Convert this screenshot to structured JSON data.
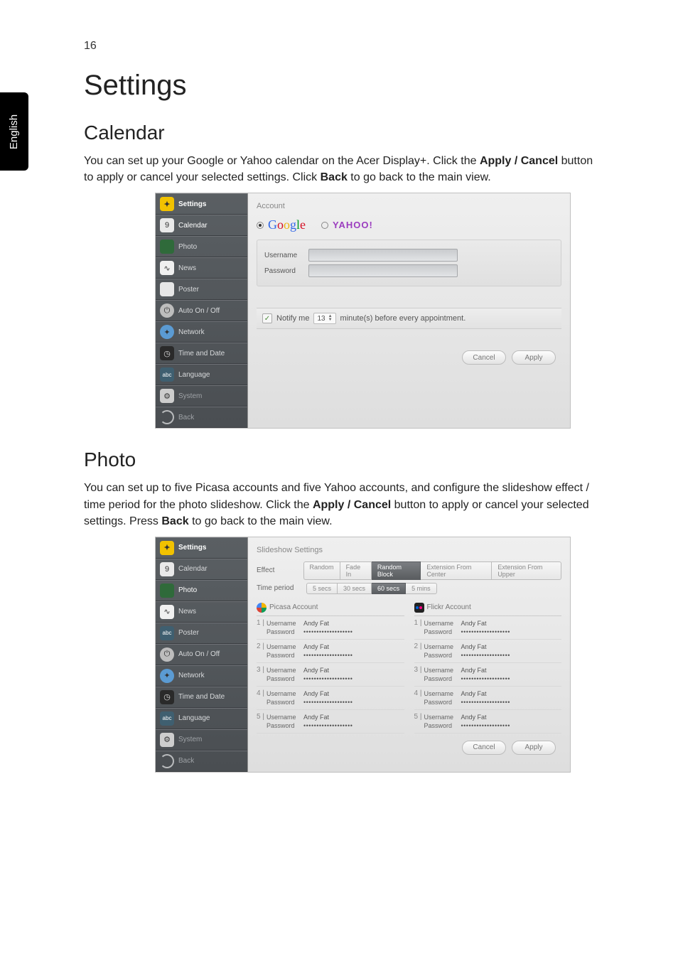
{
  "page_number": "16",
  "language_tab": "English",
  "heading_settings": "Settings",
  "calendar": {
    "heading": "Calendar",
    "para_before": "You can set up your Google or Yahoo calendar on the Acer Display+. Click the ",
    "apply_cancel": "Apply / Cancel",
    "para_mid": " button to apply or cancel your selected settings. Click ",
    "back": "Back",
    "para_after": " to go back to the main view."
  },
  "photo": {
    "heading": "Photo",
    "para_before": "You can set up to five Picasa accounts and five Yahoo accounts, and configure the slideshow effect / time period for the photo slideshow. Click the ",
    "apply_cancel": "Apply / Cancel",
    "para_mid": " button to apply or cancel your selected settings. Press ",
    "back": "Back",
    "para_after": " to go back to the main view."
  },
  "sidebar": {
    "title": "Settings",
    "items": [
      "Calendar",
      "Photo",
      "News",
      "Poster",
      "Auto On / Off",
      "Network",
      "Time and Date",
      "Language",
      "System",
      "Back"
    ]
  },
  "calendar_app": {
    "section_title": "Account",
    "radio_google": "Google",
    "radio_yahoo": "YAHOO!",
    "lbl_username": "Username",
    "lbl_password": "Password",
    "notify_label": "Notify me",
    "notify_value": "13",
    "notify_suffix": "minute(s) before every appointment.",
    "btn_cancel": "Cancel",
    "btn_apply": "Apply"
  },
  "photo_app": {
    "section_title": "Slideshow Settings",
    "lbl_effect": "Effect",
    "effects": [
      "Random",
      "Fade In",
      "Random Block",
      "Extension From Center",
      "Extension From Upper"
    ],
    "effect_selected_index": 2,
    "lbl_time": "Time period",
    "times": [
      "5 secs",
      "30 secs",
      "60 secs",
      "5 mins"
    ],
    "time_selected_index": 2,
    "picasa_title": "Picasa Account",
    "flickr_title": "Flickr Account",
    "row_lbl_username": "Username",
    "row_lbl_password": "Password",
    "default_username": "Andy Fat",
    "password_mask": "•••••••••••••••••••",
    "btn_cancel": "Cancel",
    "btn_apply": "Apply"
  }
}
